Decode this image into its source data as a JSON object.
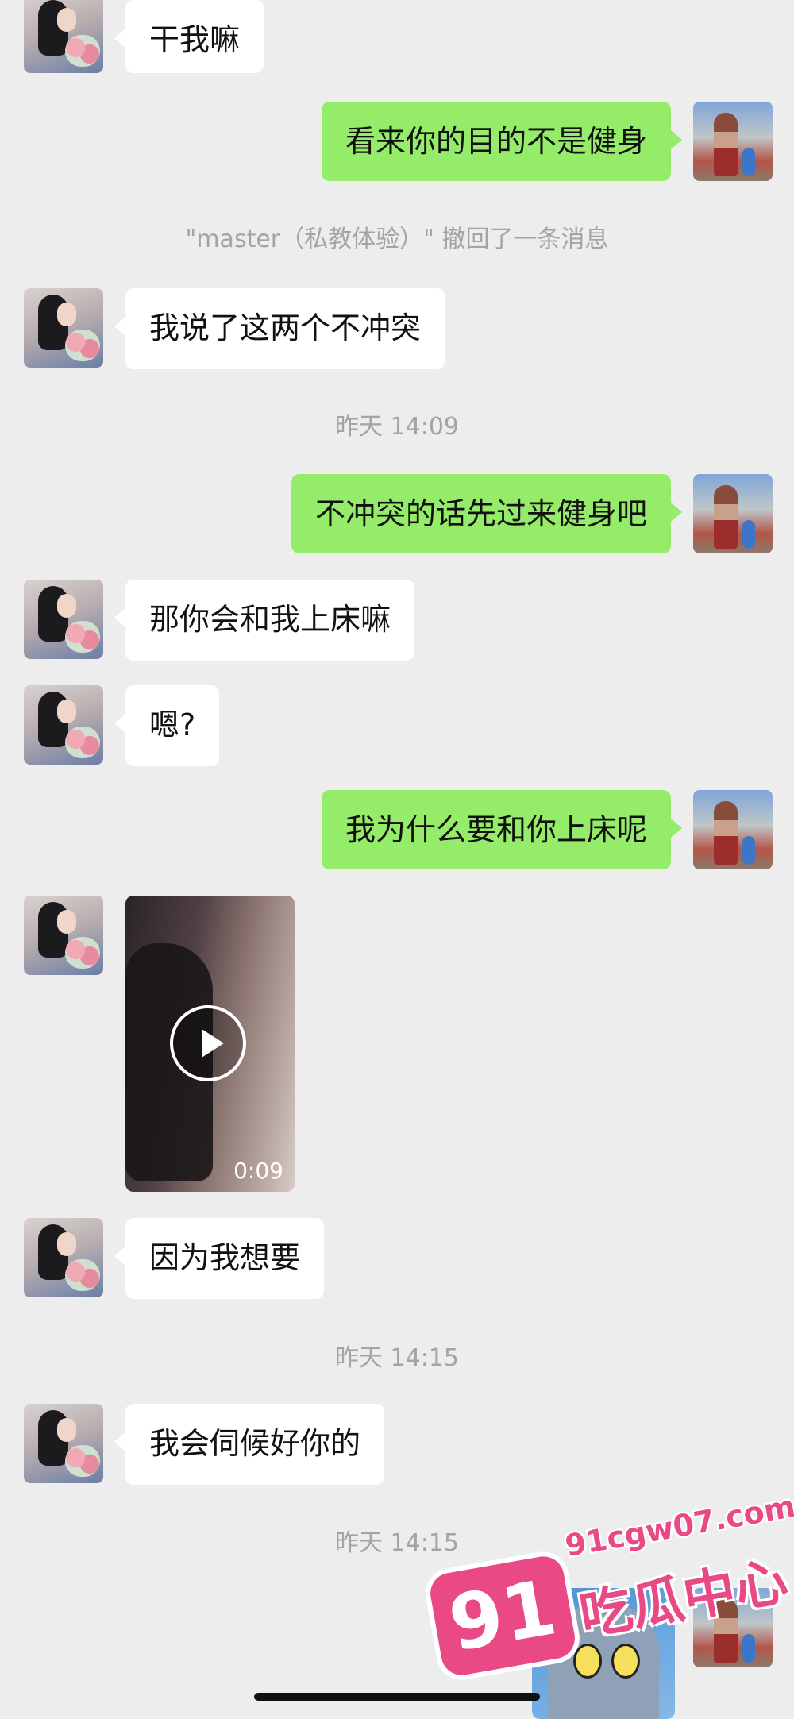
{
  "messages": [
    {
      "kind": "in",
      "text": "干我嘛"
    },
    {
      "kind": "out",
      "text": "看来你的目的不是健身"
    },
    {
      "kind": "system",
      "text": "\"master（私教体验）\" 撤回了一条消息"
    },
    {
      "kind": "in",
      "text": "我说了这两个不冲突"
    },
    {
      "kind": "time",
      "text": "昨天 14:09"
    },
    {
      "kind": "out",
      "text": "不冲突的话先过来健身吧"
    },
    {
      "kind": "in",
      "text": "那你会和我上床嘛"
    },
    {
      "kind": "in",
      "text": "嗯?"
    },
    {
      "kind": "out",
      "text": "我为什么要和你上床呢"
    },
    {
      "kind": "video",
      "duration": "0:09"
    },
    {
      "kind": "in",
      "text": "因为我想要"
    },
    {
      "kind": "time",
      "text": "昨天 14:15"
    },
    {
      "kind": "in",
      "text": "我会伺候好你的"
    },
    {
      "kind": "time",
      "text": "昨天 14:15"
    },
    {
      "kind": "sticker"
    }
  ],
  "watermark": {
    "number": "91",
    "url": "91cgw07.com",
    "text": "吃瓜中心"
  },
  "colors": {
    "background": "#ededed",
    "incoming": "#ffffff",
    "outgoing": "#95ec69",
    "watermark": "#e94a86"
  }
}
